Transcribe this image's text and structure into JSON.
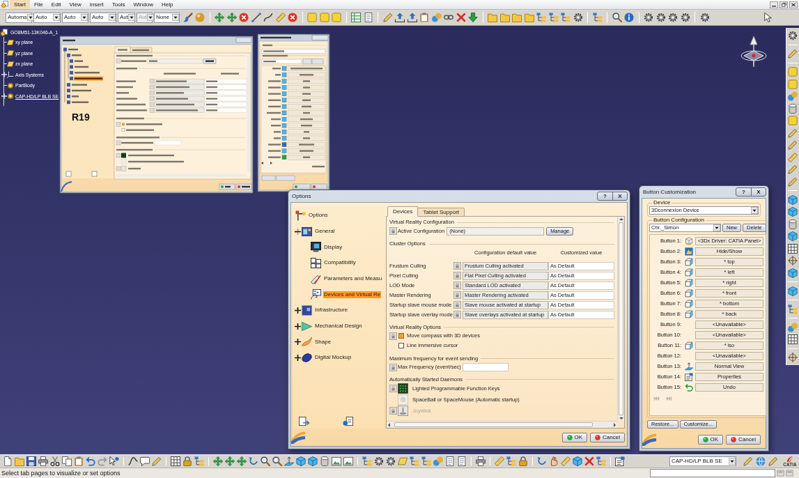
{
  "menu_bar": {
    "items": [
      {
        "label": "Start",
        "selected": true
      },
      {
        "label": "File",
        "selected": false
      },
      {
        "label": "Edit",
        "selected": false
      },
      {
        "label": "View",
        "selected": false
      },
      {
        "label": "Insert",
        "selected": false
      },
      {
        "label": "Tools",
        "selected": false
      },
      {
        "label": "Window",
        "selected": false
      },
      {
        "label": "Help",
        "selected": false
      }
    ]
  },
  "toolbar": {
    "dropdowns": [
      {
        "value": "Automa",
        "disabled": false
      },
      {
        "value": "Auto",
        "disabled": false
      },
      {
        "value": "Auto",
        "disabled": false
      },
      {
        "value": "Auto",
        "disabled": false
      },
      {
        "value": "Aut",
        "disabled": false
      },
      {
        "value": "Aut",
        "disabled": true
      },
      {
        "value": "None",
        "disabled": false
      }
    ]
  },
  "spec_tree": {
    "label": "GO8M51-13K046-A_1",
    "children": [
      {
        "label": "xy plane",
        "kind": "plane",
        "in_work": false
      },
      {
        "label": "yz plane",
        "kind": "plane",
        "in_work": false
      },
      {
        "label": "zx plane",
        "kind": "plane",
        "in_work": false
      },
      {
        "label": "Axis Systems",
        "kind": "axis",
        "expanded": false,
        "in_work": false
      },
      {
        "label": "PartBody",
        "kind": "body",
        "in_work": false
      },
      {
        "label": "CAP-HD/LP BLB SE",
        "kind": "body",
        "expanded": false,
        "in_work": true
      }
    ]
  },
  "inset": {
    "label": "R19"
  },
  "options_dialog": {
    "title": "Options",
    "title_buttons": [
      "?",
      "X"
    ],
    "tree": [
      {
        "label": "Options",
        "kind": "root",
        "selected": false,
        "children": [
          {
            "label": "General",
            "kind": "general",
            "selected": false,
            "expanded": true,
            "children": [
              {
                "label": "Display",
                "kind": "display",
                "selected": false
              },
              {
                "label": "Compatibility",
                "kind": "compatibility",
                "selected": false
              },
              {
                "label": "Parameters and Measu",
                "kind": "parameters",
                "selected": false
              },
              {
                "label": "Devices and Virtual Re",
                "kind": "devices",
                "selected": true
              }
            ]
          },
          {
            "label": "Infrastructure",
            "kind": "infrastructure",
            "selected": false,
            "expanded": false
          },
          {
            "label": "Mechanical Design",
            "kind": "mechanical",
            "selected": false,
            "expanded": false
          },
          {
            "label": "Shape",
            "kind": "shape",
            "selected": false,
            "expanded": false
          },
          {
            "label": "Digital Mockup",
            "kind": "mockup",
            "selected": false,
            "expanded": false
          }
        ]
      }
    ],
    "tabs": [
      {
        "label": "Devices",
        "selected": true
      },
      {
        "label": "Tablet Support",
        "selected": false
      }
    ],
    "vr_configuration": {
      "title": "Virtual Reality Configuration",
      "label": "Active Configuration",
      "value": "(None)",
      "button": "Manage"
    },
    "cluster_options": {
      "title": "Cluster Options",
      "columns": [
        "Configuration default value",
        "Customized value"
      ],
      "rows": [
        {
          "label": "Frustum Culling",
          "default": "Frustum Culling activated",
          "custom": "As Default"
        },
        {
          "label": "Pixel Culling",
          "default": "Flat Pixel Culling activated",
          "custom": "As Default"
        },
        {
          "label": "LOD Mode",
          "default": "Standard LOD activated",
          "custom": "As Default"
        },
        {
          "label": "Master Rendering",
          "default": "Master Rendering activated",
          "custom": "As Default"
        },
        {
          "label": "Startup slave mouse mode",
          "default": "Slave mouse activated at startup",
          "custom": "As Default"
        },
        {
          "label": "Startup slave overlay mode",
          "default": "Slave overlays activated at startup",
          "custom": "As Default"
        }
      ]
    },
    "vr_options": {
      "title": "Virtual Reality Options",
      "checkboxes": [
        {
          "label": "Move compass with 3D devices",
          "checked": true,
          "lock_icon": true
        },
        {
          "label": "Line immersive cursor",
          "checked": false,
          "lock_icon": false
        }
      ]
    },
    "max_frequency": {
      "title": "Maximum frequency for event sending",
      "label": "Max Frequency (event/sec)"
    },
    "daemons": {
      "title": "Automatically Started Daemons",
      "items": [
        {
          "label": "Lighted Programmable Function Keys",
          "kind": "keypad",
          "lock_icon": true,
          "disabled": false
        },
        {
          "label": "SpaceBall or SpaceMouse (Automatic startup)",
          "kind": "spaceball",
          "lock_icon": false,
          "disabled": false
        },
        {
          "label": "Joystick",
          "kind": "joystick",
          "lock_icon": true,
          "disabled": true
        }
      ]
    },
    "buttons": [
      {
        "label": "OK",
        "kind": "ok"
      },
      {
        "label": "Cancel",
        "kind": "cancel"
      }
    ]
  },
  "button_dialog": {
    "title": "Button Customization",
    "title_buttons": [
      "?",
      "X"
    ],
    "device_label": "Device",
    "device": "3Dconnexion Device",
    "config_label": "Button Configuration",
    "config": "Chr._Simon",
    "config_buttons": [
      "New",
      "Delete"
    ],
    "rows": [
      {
        "label": "Button 1:",
        "kind": "driver",
        "value": "<3Dx Driver: CATIA Panel>"
      },
      {
        "label": "Button 2:",
        "kind": "hide-show",
        "value": "Hide/Show"
      },
      {
        "label": "Button 3:",
        "kind": "view",
        "value": "* top"
      },
      {
        "label": "Button 4:",
        "kind": "view",
        "value": "* left"
      },
      {
        "label": "Button 5:",
        "kind": "view",
        "value": "* right"
      },
      {
        "label": "Button 6:",
        "kind": "view",
        "value": "* front"
      },
      {
        "label": "Button 7:",
        "kind": "view",
        "value": "* bottom"
      },
      {
        "label": "Button 8:",
        "kind": "view",
        "value": "* back"
      },
      {
        "label": "Button 9:",
        "kind": "empty",
        "value": "<Unavailable>"
      },
      {
        "label": "Button 10:",
        "kind": "empty",
        "value": "<Unavailable>"
      },
      {
        "label": "Button 11:",
        "kind": "view",
        "value": "* iso"
      },
      {
        "label": "Button 12:",
        "kind": "empty",
        "value": "<Unavailable>"
      },
      {
        "label": "Button 13:",
        "kind": "normal-view",
        "value": "Normal View"
      },
      {
        "label": "Button 14:",
        "kind": "properties",
        "value": "Properties"
      },
      {
        "label": "Button 15:",
        "kind": "undo",
        "value": "Undo"
      }
    ],
    "pager": {
      "previous_enabled": false,
      "next_enabled": false
    },
    "footer_buttons": [
      "Restore...",
      "Customize..."
    ],
    "buttons": [
      {
        "label": "OK",
        "kind": "ok"
      },
      {
        "label": "Cancel",
        "kind": "cancel"
      }
    ]
  },
  "bottom_toolbar": {
    "dropdown": "CAP-HD/LP BLB SE",
    "logo_text": "CATIA"
  },
  "status_bar": {
    "message": "Select tab pages to visualize or set options"
  }
}
